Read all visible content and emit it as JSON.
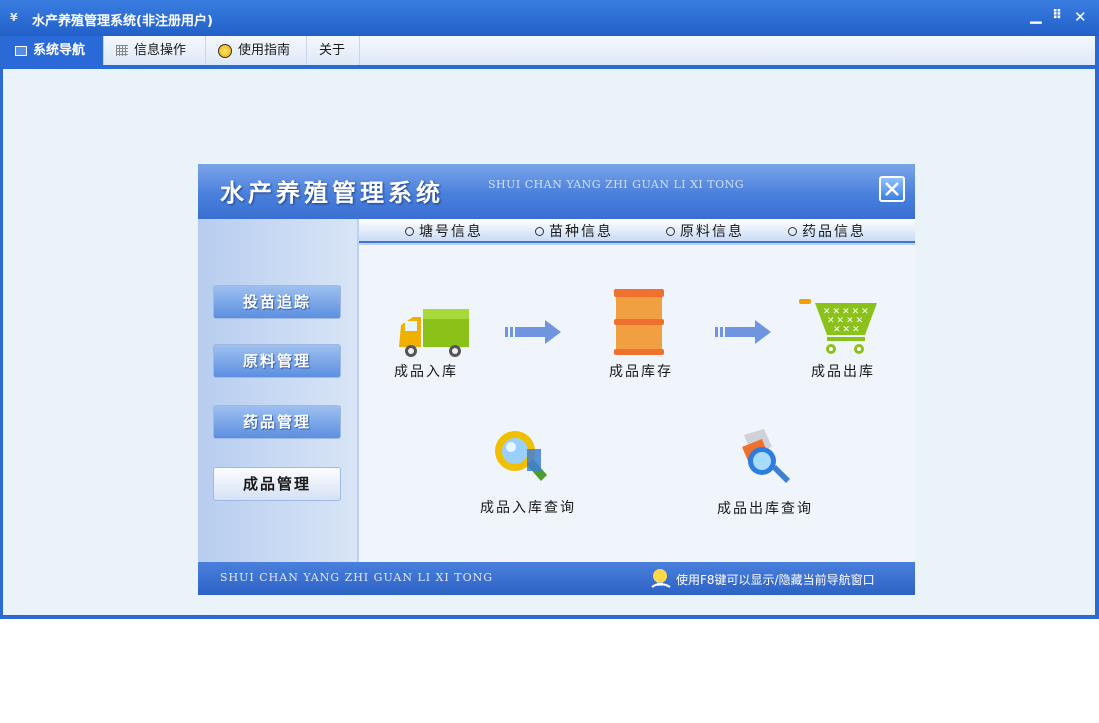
{
  "window": {
    "title": "水产养殖管理系统(非注册用户)",
    "icon_label": "¥",
    "minimize": "▁",
    "restore": "⠿",
    "close": "✕"
  },
  "menu": {
    "tabs": [
      {
        "label": "系统导航",
        "icon": "monitor-icon",
        "active": true
      },
      {
        "label": "信息操作",
        "icon": "grid-icon",
        "active": false
      },
      {
        "label": "使用指南",
        "icon": "bulb-icon",
        "active": false
      },
      {
        "label": "关于",
        "icon": "",
        "active": false
      }
    ]
  },
  "panel": {
    "title": "水产养殖管理系统",
    "subtitle": "SHUI CHAN YANG ZHI GUAN LI XI TONG",
    "side_buttons": [
      "投苗追踪",
      "原料管理",
      "药品管理",
      "成品管理"
    ],
    "active_side_button": "成品管理",
    "info_links": [
      "塘号信息",
      "苗种信息",
      "原料信息",
      "药品信息"
    ],
    "features": {
      "stock_in": "成品入库",
      "inventory": "成品库存",
      "stock_out": "成品出库",
      "stock_in_query": "成品入库查询",
      "stock_out_query": "成品出库查询"
    },
    "footer_left": "SHUI CHAN YANG ZHI GUAN LI XI TONG",
    "footer_hint": "使用F8键可以显示/隐藏当前导航窗口"
  },
  "colors": {
    "accent": "#2a6ad8",
    "titlebar": "#2b6ad3",
    "panel_bg": "#bcd0ef",
    "content_bg": "#ebf3fa"
  }
}
